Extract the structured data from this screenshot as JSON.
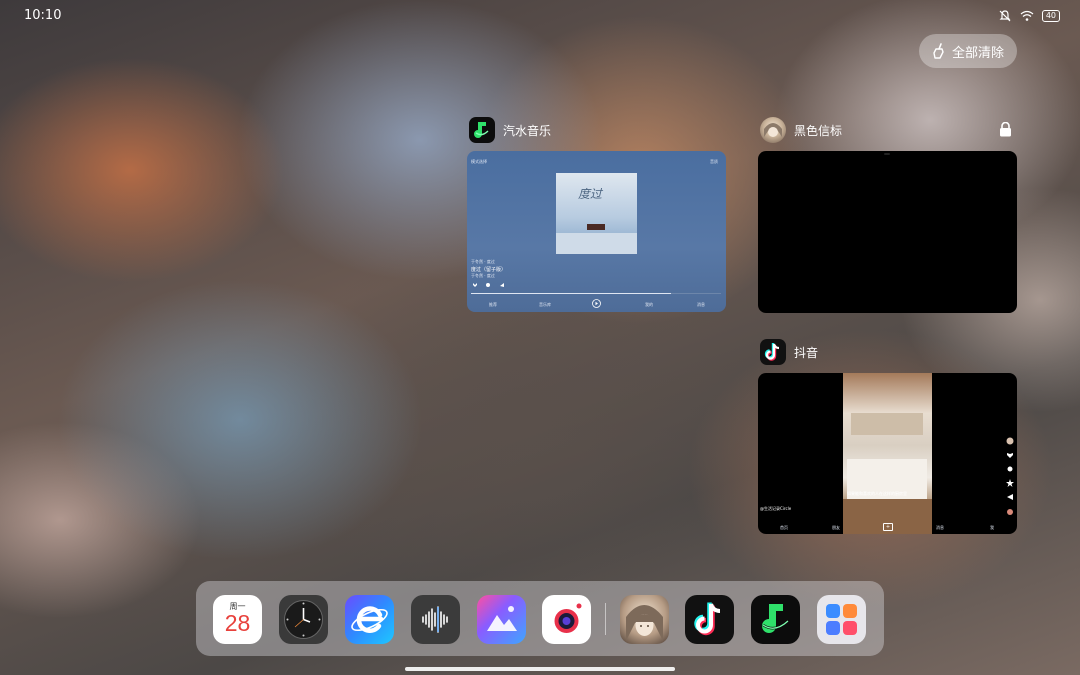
{
  "status_bar": {
    "time": "10:10",
    "icons": [
      "mute-bell-icon",
      "wifi-icon",
      "battery-icon"
    ],
    "battery": "40"
  },
  "recents": {
    "clear_all_label": "全部清除",
    "cards": [
      {
        "app": "汽水音乐",
        "icon": "qishui-music-icon",
        "locked": false
      },
      {
        "app": "黑色信标",
        "icon": "anime-avatar-icon",
        "locked": true
      },
      {
        "app": "抖音",
        "icon": "douyin-icon",
        "locked": false
      }
    ],
    "music_preview": {
      "top_left": "模式选择",
      "top_right": "音质",
      "album_title": "度过",
      "song_title": "度过（留子版）",
      "artist": "于冬然 · 度过",
      "tabs": [
        "推荐",
        "音乐库",
        "播放",
        "我的",
        "消息"
      ]
    },
    "douyin_preview": {
      "author": "@生活记录Circle",
      "caption": "如果能和喜欢的人在这样的厨房里",
      "tabs": [
        "首页",
        "朋友",
        "+",
        "消息",
        "我"
      ]
    }
  },
  "dock": {
    "calendar": {
      "weekday": "周一",
      "day": "28"
    },
    "apps": [
      {
        "name": "calendar-app",
        "icon": "calendar-icon"
      },
      {
        "name": "clock-app",
        "icon": "clock-icon"
      },
      {
        "name": "browser-app",
        "icon": "browser-icon"
      },
      {
        "name": "voice-recorder-app",
        "icon": "waveform-icon"
      },
      {
        "name": "gallery-app",
        "icon": "gallery-icon"
      },
      {
        "name": "camera-app",
        "icon": "camera-icon"
      },
      {
        "name": "black-beacon-app",
        "icon": "anime-avatar-icon"
      },
      {
        "name": "douyin-app",
        "icon": "douyin-icon"
      },
      {
        "name": "qishui-music-app",
        "icon": "qishui-music-icon"
      },
      {
        "name": "more-apps-folder",
        "icon": "app-folder-icon"
      }
    ]
  },
  "colors": {
    "qishui_green": "#2fe06a",
    "douyin_cyan": "#25f4ee",
    "douyin_red": "#fe2c55",
    "calendar_red": "#e8413c",
    "camera_red": "#e8304a"
  }
}
